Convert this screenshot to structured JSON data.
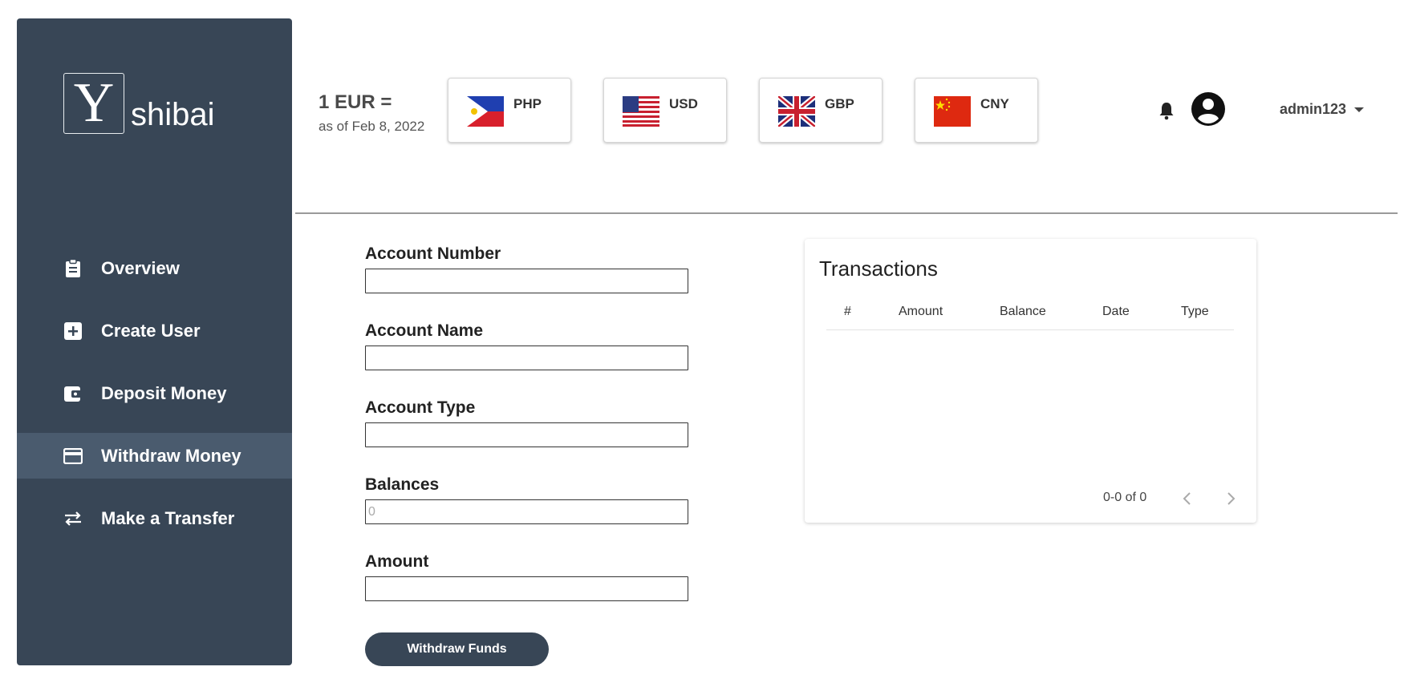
{
  "brand": {
    "logo_letter": "Y",
    "name": "shibai"
  },
  "nav": {
    "items": [
      {
        "label": "Overview",
        "icon": "clipboard-icon"
      },
      {
        "label": "Create User",
        "icon": "plus-box-icon"
      },
      {
        "label": "Deposit Money",
        "icon": "wallet-icon"
      },
      {
        "label": "Withdraw Money",
        "icon": "credit-card-icon",
        "active": true
      },
      {
        "label": "Make a Transfer",
        "icon": "transfer-arrows-icon"
      }
    ]
  },
  "rates": {
    "title": "1 EUR =",
    "subtitle": "as of Feb 8, 2022",
    "currencies": [
      "PHP",
      "USD",
      "GBP",
      "CNY"
    ]
  },
  "user": {
    "name": "admin123"
  },
  "form": {
    "account_number_label": "Account Number",
    "account_name_label": "Account Name",
    "account_type_label": "Account Type",
    "balances_label": "Balances",
    "balances_placeholder": "0",
    "amount_label": "Amount",
    "submit_label": "Withdraw Funds"
  },
  "transactions": {
    "title": "Transactions",
    "columns": [
      "#",
      "Amount",
      "Balance",
      "Date",
      "Type"
    ],
    "rows": [],
    "pagination": "0-0 of 0"
  },
  "colors": {
    "sidebar": "#384656",
    "sidebar_active": "#4a5b6e",
    "button": "#384656"
  }
}
